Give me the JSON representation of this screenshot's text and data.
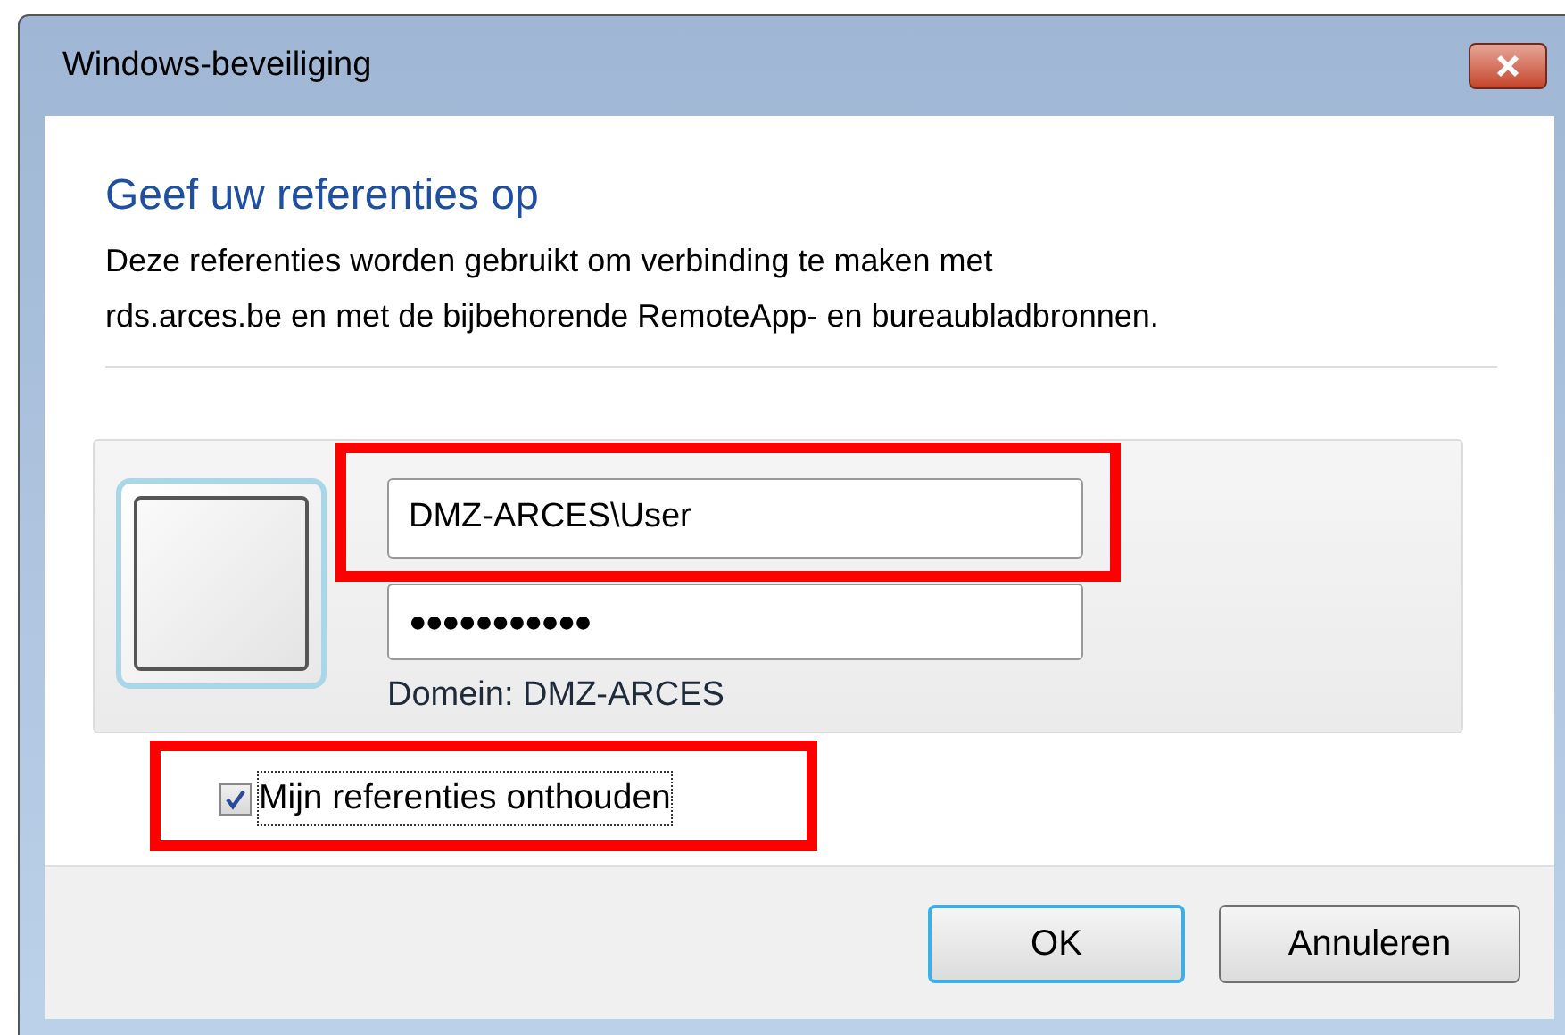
{
  "window": {
    "title": "Windows-beveiliging"
  },
  "heading": "Geef uw referenties op",
  "description": "Deze referenties worden gebruikt om verbinding te maken met\nrds.arces.be en met de bijbehorende RemoteApp- en bureaubladbronnen.",
  "credentials": {
    "username": {
      "value": "DMZ-ARCES\\User",
      "highlighted": true
    },
    "password": {
      "value": "●●●●●●●●●●●"
    },
    "domain": "Domein: DMZ-ARCES"
  },
  "remember": {
    "label": "Mijn referenties onthouden",
    "checked": true,
    "focused": true,
    "highlighted": true
  },
  "buttons": [
    {
      "label": "OK",
      "default": true
    },
    {
      "label": "Annuleren",
      "default": false
    }
  ]
}
